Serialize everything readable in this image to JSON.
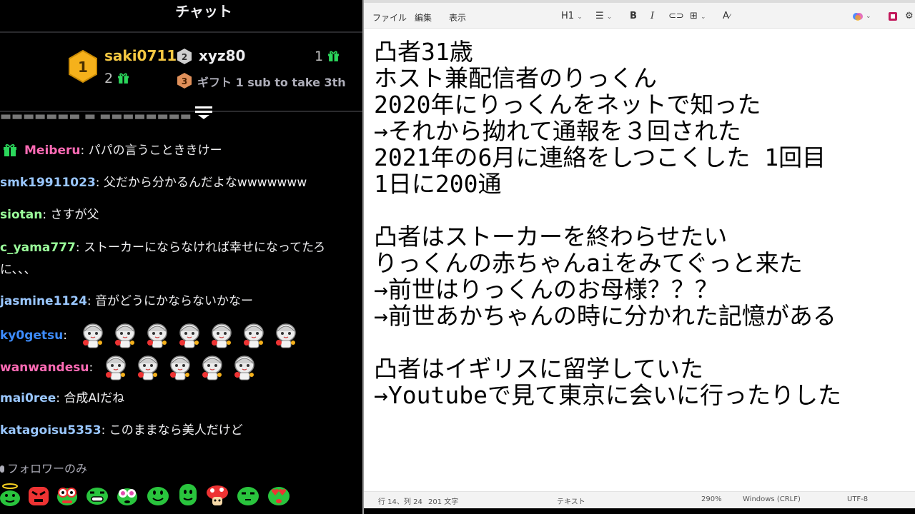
{
  "chat": {
    "title": "チャット",
    "leaderboard": {
      "first": {
        "rank": "1",
        "name": "saki0711",
        "count": "2"
      },
      "second": {
        "rank": "2",
        "name": "xyz80",
        "count": "1"
      },
      "third": {
        "rank": "3",
        "cta": "ギフト 1 sub to take 3th"
      }
    },
    "messages": [
      {
        "user": "Meiberu",
        "text": ": パパの言うことききけー",
        "color": "#ff6bb5",
        "gift_badge": true
      },
      {
        "user": "smk19911023",
        "text": ": 父だから分かるんだよなwwwwwww",
        "color": "#9ac7ff"
      },
      {
        "user": "siotan",
        "text": ": さすが父",
        "color": "#9bff9b"
      },
      {
        "user": "c_yama777",
        "text": ": ストーカーにならなければ幸せになってたろ",
        "text2": "に、、、",
        "color": "#9bff9b"
      },
      {
        "user": "jasmine1124",
        "text": ": 音がどうにかならないかなー",
        "color": "#9ac7ff"
      },
      {
        "user": "ky0getsu",
        "text": ":",
        "color": "#3d8cff",
        "emotes": 7
      },
      {
        "user": "wanwandesu",
        "text": ":",
        "color": "#ff6bb5",
        "emotes": 5
      },
      {
        "user": "mai0ree",
        "text": ": 合成AIだね",
        "color": "#9ac7ff"
      },
      {
        "user": "katagoisu5353",
        "text": ": このままなら美人だけど",
        "color": "#9ac7ff"
      }
    ],
    "followers_only": "フォロワーのみ"
  },
  "notepad": {
    "menu": [
      "ファイル",
      "編集",
      "表示"
    ],
    "toolbar": {
      "heading": "H1",
      "bold": "B",
      "italic": "I",
      "clear": "A"
    },
    "lines": [
      "凸者31歳",
      "ホスト兼配信者のりっくん",
      "2020年にりっくんをネットで知った",
      "→それから拗れて通報を３回された",
      "2021年の6月に連絡をしつこくした 1回目",
      "1日に200通",
      "",
      "凸者はストーカーを終わらせたい",
      "りっくんの赤ちゃんaiをみてぐっと来た",
      "→前世はりっくんのお母様？？？",
      "→前世あかちゃんの時に分かれた記憶がある",
      "",
      "凸者はイギリスに留学していた",
      "→Youtubeで見て東京に会いに行ったりした"
    ],
    "status": {
      "position": "行 14、列 24",
      "chars": "201 文字",
      "format": "テキスト",
      "zoom": "290%",
      "eol": "Windows (CRLF)",
      "encoding": "UTF-8"
    }
  },
  "colors": {
    "chat_bg": "#000000",
    "gift_green": "#2bd65b",
    "gold_badge": "#f5b11b",
    "notepad_bg": "#ffffff"
  }
}
